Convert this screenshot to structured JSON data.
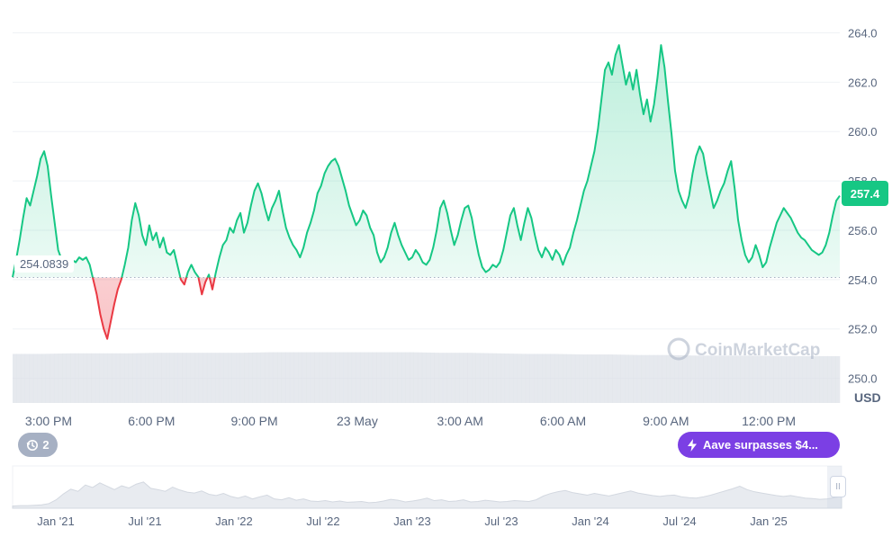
{
  "chart_data": {
    "type": "line",
    "currency": "USD",
    "reference_price": 254.0839,
    "reference_label": "254.0839",
    "current_price": 257.4,
    "current_label": "257.4",
    "ylim": [
      249.0,
      264.6
    ],
    "y_ticks": [
      "264.0",
      "262.0",
      "260.0",
      "258.0",
      "256.0",
      "254.0",
      "252.0",
      "250.0"
    ],
    "x_tick_labels": [
      "3:00 PM",
      "6:00 PM",
      "9:00 PM",
      "23 May",
      "3:00 AM",
      "6:00 AM",
      "9:00 AM",
      "12:00 PM"
    ],
    "series": [
      {
        "values": [
          254.1,
          254.8,
          255.6,
          256.5,
          257.3,
          257.0,
          257.6,
          258.2,
          258.9,
          259.2,
          258.6,
          257.4,
          256.3,
          255.2,
          254.8,
          254.5,
          254.6,
          254.8,
          254.7,
          254.9,
          254.8,
          254.9,
          254.6,
          254.0,
          253.4,
          252.6,
          252.0,
          251.6,
          252.3,
          253.0,
          253.6,
          254.0,
          254.6,
          255.3,
          256.4,
          257.1,
          256.6,
          255.8,
          255.4,
          256.2,
          255.6,
          255.9,
          255.3,
          255.7,
          255.1,
          255.0,
          255.2,
          254.6,
          254.0,
          253.8,
          254.3,
          254.6,
          254.3,
          254.1,
          253.4,
          253.9,
          254.2,
          253.6,
          254.3,
          254.9,
          255.4,
          255.6,
          256.1,
          255.9,
          256.4,
          256.7,
          255.9,
          256.3,
          257.0,
          257.6,
          257.9,
          257.5,
          256.9,
          256.4,
          256.9,
          257.2,
          257.6,
          256.8,
          256.1,
          255.7,
          255.4,
          255.2,
          254.9,
          255.3,
          255.9,
          256.3,
          256.8,
          257.5,
          257.8,
          258.3,
          258.6,
          258.8,
          258.9,
          258.6,
          258.1,
          257.6,
          257.0,
          256.6,
          256.2,
          256.4,
          256.8,
          256.6,
          256.1,
          255.8,
          255.1,
          254.7,
          254.9,
          255.3,
          255.9,
          256.3,
          255.8,
          255.4,
          255.1,
          254.8,
          254.9,
          255.2,
          255.0,
          254.7,
          254.6,
          254.8,
          255.3,
          256.0,
          256.9,
          257.2,
          256.7,
          256.0,
          255.4,
          255.8,
          256.4,
          256.9,
          257.0,
          256.5,
          255.7,
          255.0,
          254.5,
          254.3,
          254.4,
          254.6,
          254.5,
          254.7,
          255.2,
          255.9,
          256.6,
          256.9,
          256.2,
          255.6,
          256.3,
          256.9,
          256.5,
          255.8,
          255.2,
          254.9,
          255.3,
          255.1,
          254.8,
          255.2,
          255.0,
          254.6,
          255.0,
          255.3,
          255.9,
          256.4,
          257.0,
          257.6,
          258.0,
          258.6,
          259.2,
          260.1,
          261.3,
          262.5,
          262.8,
          262.3,
          263.1,
          263.5,
          262.7,
          261.9,
          262.4,
          261.7,
          262.5,
          261.5,
          260.7,
          261.3,
          260.4,
          261.1,
          262.2,
          263.5,
          262.6,
          261.2,
          259.9,
          258.4,
          257.6,
          257.2,
          256.9,
          257.4,
          258.3,
          259.0,
          259.4,
          259.1,
          258.3,
          257.6,
          256.9,
          257.2,
          257.6,
          257.9,
          258.4,
          258.8,
          257.7,
          256.4,
          255.6,
          255.0,
          254.7,
          254.9,
          255.4,
          255.0,
          254.5,
          254.7,
          255.3,
          255.8,
          256.3,
          256.6,
          256.9,
          256.7,
          256.5,
          256.2,
          255.9,
          255.7,
          255.6,
          255.4,
          255.2,
          255.1,
          255.0,
          255.1,
          255.4,
          255.9,
          256.6,
          257.2,
          257.4
        ]
      }
    ],
    "volume_series": [
      0.88,
      0.88,
      0.89,
      0.89,
      0.89,
      0.9,
      0.9,
      0.9,
      0.9,
      0.91,
      0.91,
      0.91,
      0.91,
      0.91,
      0.91,
      0.9,
      0.9,
      0.89,
      0.88,
      0.88,
      0.87,
      0.87,
      0.86,
      0.86,
      0.85,
      0.85,
      0.85,
      0.84,
      0.84,
      0.84
    ],
    "navigator": {
      "x_labels": [
        "Jan '21",
        "Jul '21",
        "Jan '22",
        "Jul '22",
        "Jan '23",
        "Jul '23",
        "Jan '24",
        "Jul '24",
        "Jan '25"
      ],
      "values": [
        0.05,
        0.06,
        0.06,
        0.07,
        0.08,
        0.11,
        0.2,
        0.34,
        0.45,
        0.4,
        0.55,
        0.49,
        0.6,
        0.52,
        0.44,
        0.53,
        0.48,
        0.57,
        0.62,
        0.47,
        0.44,
        0.4,
        0.5,
        0.43,
        0.38,
        0.36,
        0.41,
        0.33,
        0.3,
        0.35,
        0.28,
        0.24,
        0.29,
        0.22,
        0.27,
        0.31,
        0.22,
        0.2,
        0.25,
        0.19,
        0.22,
        0.17,
        0.16,
        0.18,
        0.15,
        0.17,
        0.14,
        0.15,
        0.16,
        0.13,
        0.14,
        0.17,
        0.21,
        0.19,
        0.15,
        0.17,
        0.2,
        0.24,
        0.18,
        0.2,
        0.16,
        0.17,
        0.2,
        0.15,
        0.16,
        0.19,
        0.17,
        0.15,
        0.16,
        0.18,
        0.17,
        0.16,
        0.2,
        0.29,
        0.35,
        0.39,
        0.42,
        0.37,
        0.34,
        0.31,
        0.35,
        0.32,
        0.29,
        0.33,
        0.37,
        0.41,
        0.36,
        0.33,
        0.3,
        0.28,
        0.3,
        0.31,
        0.27,
        0.25,
        0.24,
        0.27,
        0.31,
        0.36,
        0.41,
        0.46,
        0.52,
        0.44,
        0.39,
        0.36,
        0.33,
        0.3,
        0.28,
        0.3,
        0.27,
        0.24,
        0.23,
        0.21,
        0.22,
        0.25,
        0.28
      ]
    },
    "watermark": "CoinMarketCap",
    "grid": true
  },
  "ui": {
    "usd_label": "USD",
    "history_count": "2",
    "event_badge": "Aave surpasses $4...",
    "navigator_handle": "II"
  },
  "colors": {
    "up": "#16c784",
    "down": "#ea3943",
    "event_badge": "#7b3fe4",
    "history_pill": "#a6b0c3",
    "grid": "#eff2f5",
    "reference_line": "#a6b0c3"
  }
}
